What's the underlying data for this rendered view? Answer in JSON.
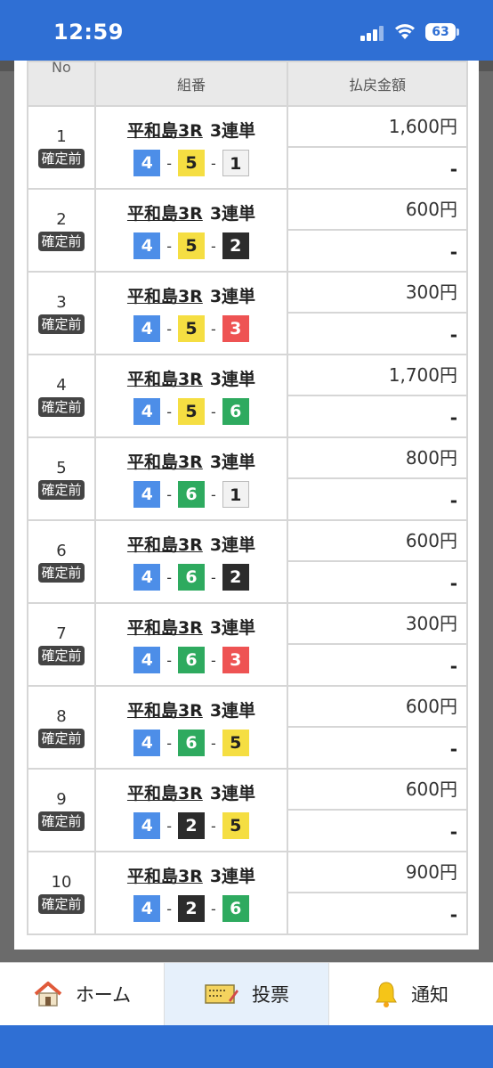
{
  "status": {
    "time": "12:59",
    "battery": "63"
  },
  "table": {
    "headers": {
      "no": "No",
      "combo": "組番",
      "payout": "払戻金額"
    },
    "rows": [
      {
        "no": "1",
        "status": "確定前",
        "venue": "平和島3R",
        "type": "3連単",
        "boats": [
          "4",
          "5",
          "1"
        ],
        "payout": "1,600円",
        "result": "-"
      },
      {
        "no": "2",
        "status": "確定前",
        "venue": "平和島3R",
        "type": "3連単",
        "boats": [
          "4",
          "5",
          "2"
        ],
        "payout": "600円",
        "result": "-"
      },
      {
        "no": "3",
        "status": "確定前",
        "venue": "平和島3R",
        "type": "3連単",
        "boats": [
          "4",
          "5",
          "3"
        ],
        "payout": "300円",
        "result": "-"
      },
      {
        "no": "4",
        "status": "確定前",
        "venue": "平和島3R",
        "type": "3連単",
        "boats": [
          "4",
          "5",
          "6"
        ],
        "payout": "1,700円",
        "result": "-"
      },
      {
        "no": "5",
        "status": "確定前",
        "venue": "平和島3R",
        "type": "3連単",
        "boats": [
          "4",
          "6",
          "1"
        ],
        "payout": "800円",
        "result": "-"
      },
      {
        "no": "6",
        "status": "確定前",
        "venue": "平和島3R",
        "type": "3連単",
        "boats": [
          "4",
          "6",
          "2"
        ],
        "payout": "600円",
        "result": "-"
      },
      {
        "no": "7",
        "status": "確定前",
        "venue": "平和島3R",
        "type": "3連単",
        "boats": [
          "4",
          "6",
          "3"
        ],
        "payout": "300円",
        "result": "-"
      },
      {
        "no": "8",
        "status": "確定前",
        "venue": "平和島3R",
        "type": "3連単",
        "boats": [
          "4",
          "6",
          "5"
        ],
        "payout": "600円",
        "result": "-"
      },
      {
        "no": "9",
        "status": "確定前",
        "venue": "平和島3R",
        "type": "3連単",
        "boats": [
          "4",
          "2",
          "5"
        ],
        "payout": "600円",
        "result": "-"
      },
      {
        "no": "10",
        "status": "確定前",
        "venue": "平和島3R",
        "type": "3連単",
        "boats": [
          "4",
          "2",
          "6"
        ],
        "payout": "900円",
        "result": "-"
      }
    ]
  },
  "tabs": [
    {
      "label": "ホーム",
      "icon": "home-icon"
    },
    {
      "label": "投票",
      "icon": "ticket-icon"
    },
    {
      "label": "通知",
      "icon": "bell-icon"
    }
  ],
  "colors": {
    "primary": "#2f6fd4",
    "boat1": "#f2f2f2",
    "boat2": "#2c2c2c",
    "boat3": "#ee5353",
    "boat4": "#4d8ee8",
    "boat5": "#f5de42",
    "boat6": "#2eaa5f"
  }
}
